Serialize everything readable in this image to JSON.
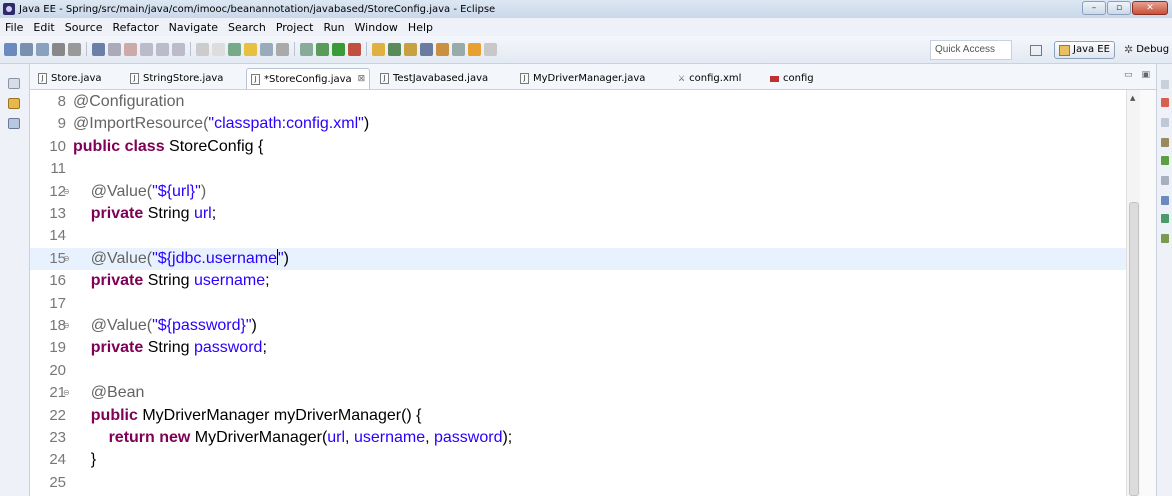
{
  "window": {
    "title": "Java EE - Spring/src/main/java/com/imooc/beanannotation/javabased/StoreConfig.java - Eclipse"
  },
  "menu": [
    "File",
    "Edit",
    "Source",
    "Refactor",
    "Navigate",
    "Search",
    "Project",
    "Run",
    "Window",
    "Help"
  ],
  "toolbar": {
    "quick_access_placeholder": "Quick Access",
    "perspectives": [
      {
        "label": "Java EE",
        "active": true
      },
      {
        "label": "Debug",
        "active": false
      }
    ]
  },
  "tabs": [
    {
      "label": "Store.java",
      "icon": "java-file-icon"
    },
    {
      "label": "StringStore.java",
      "icon": "java-file-icon"
    },
    {
      "label": "*StoreConfig.java",
      "icon": "java-file-icon",
      "active": true,
      "close": "⊠"
    },
    {
      "label": "TestJavabased.java",
      "icon": "java-file-icon"
    },
    {
      "label": "MyDriverManager.java",
      "icon": "java-file-icon"
    },
    {
      "label": "config.xml",
      "icon": "xml-file-icon"
    },
    {
      "label": "config",
      "icon": "properties-file-icon"
    }
  ],
  "editor": {
    "lines": [
      {
        "n": "8",
        "tokens": [
          {
            "t": "@Configuration",
            "c": "ann"
          }
        ]
      },
      {
        "n": "9",
        "tokens": [
          {
            "t": "@ImportResource(",
            "c": "ann"
          },
          {
            "t": "\"classpath:config.xml\"",
            "c": "str"
          },
          {
            "t": ")",
            "c": "plain"
          }
        ]
      },
      {
        "n": "10",
        "tokens": [
          {
            "t": "public ",
            "c": "kw"
          },
          {
            "t": "class ",
            "c": "kw"
          },
          {
            "t": "StoreConfig {",
            "c": "plain"
          }
        ]
      },
      {
        "n": "11",
        "tokens": []
      },
      {
        "n": "12",
        "fold": true,
        "tokens": [
          {
            "t": "    @Value(",
            "c": "ann"
          },
          {
            "t": "\"${url}\"",
            "c": "str"
          },
          {
            "t": ")",
            "c": "ann"
          }
        ]
      },
      {
        "n": "13",
        "tokens": [
          {
            "t": "    private ",
            "c": "kw"
          },
          {
            "t": "String ",
            "c": "plain"
          },
          {
            "t": "url",
            "c": "str"
          },
          {
            "t": ";",
            "c": "plain"
          }
        ]
      },
      {
        "n": "14",
        "tokens": []
      },
      {
        "n": "15",
        "fold": true,
        "current": true,
        "tokens": [
          {
            "t": "    @Value(",
            "c": "ann"
          },
          {
            "t": "\"${jdbc.username",
            "c": "str"
          },
          {
            "t": "CARET",
            "c": "caret"
          },
          {
            "t": "\"",
            "c": "str"
          },
          {
            "t": ")",
            "c": "plain"
          }
        ]
      },
      {
        "n": "16",
        "tokens": [
          {
            "t": "    private ",
            "c": "kw"
          },
          {
            "t": "String ",
            "c": "plain"
          },
          {
            "t": "username",
            "c": "str"
          },
          {
            "t": ";",
            "c": "plain"
          }
        ]
      },
      {
        "n": "17",
        "tokens": []
      },
      {
        "n": "18",
        "fold": true,
        "tokens": [
          {
            "t": "    @Value(",
            "c": "ann"
          },
          {
            "t": "\"${password}\"",
            "c": "str"
          },
          {
            "t": ")",
            "c": "plain"
          }
        ]
      },
      {
        "n": "19",
        "tokens": [
          {
            "t": "    private ",
            "c": "kw"
          },
          {
            "t": "String ",
            "c": "plain"
          },
          {
            "t": "password",
            "c": "str"
          },
          {
            "t": ";",
            "c": "plain"
          }
        ]
      },
      {
        "n": "20",
        "tokens": []
      },
      {
        "n": "21",
        "fold": true,
        "tokens": [
          {
            "t": "    @Bean",
            "c": "ann"
          }
        ]
      },
      {
        "n": "22",
        "tokens": [
          {
            "t": "    public ",
            "c": "kw"
          },
          {
            "t": "MyDriverManager myDriverManager() {",
            "c": "plain"
          }
        ]
      },
      {
        "n": "23",
        "tokens": [
          {
            "t": "        return ",
            "c": "kw"
          },
          {
            "t": "new ",
            "c": "kw"
          },
          {
            "t": "MyDriverManager(",
            "c": "plain"
          },
          {
            "t": "url",
            "c": "str"
          },
          {
            "t": ", ",
            "c": "plain"
          },
          {
            "t": "username",
            "c": "str"
          },
          {
            "t": ", ",
            "c": "plain"
          },
          {
            "t": "password",
            "c": "str"
          },
          {
            "t": ");",
            "c": "plain"
          }
        ]
      },
      {
        "n": "24",
        "tokens": [
          {
            "t": "    }",
            "c": "plain"
          }
        ]
      },
      {
        "n": "25",
        "tokens": []
      }
    ]
  }
}
